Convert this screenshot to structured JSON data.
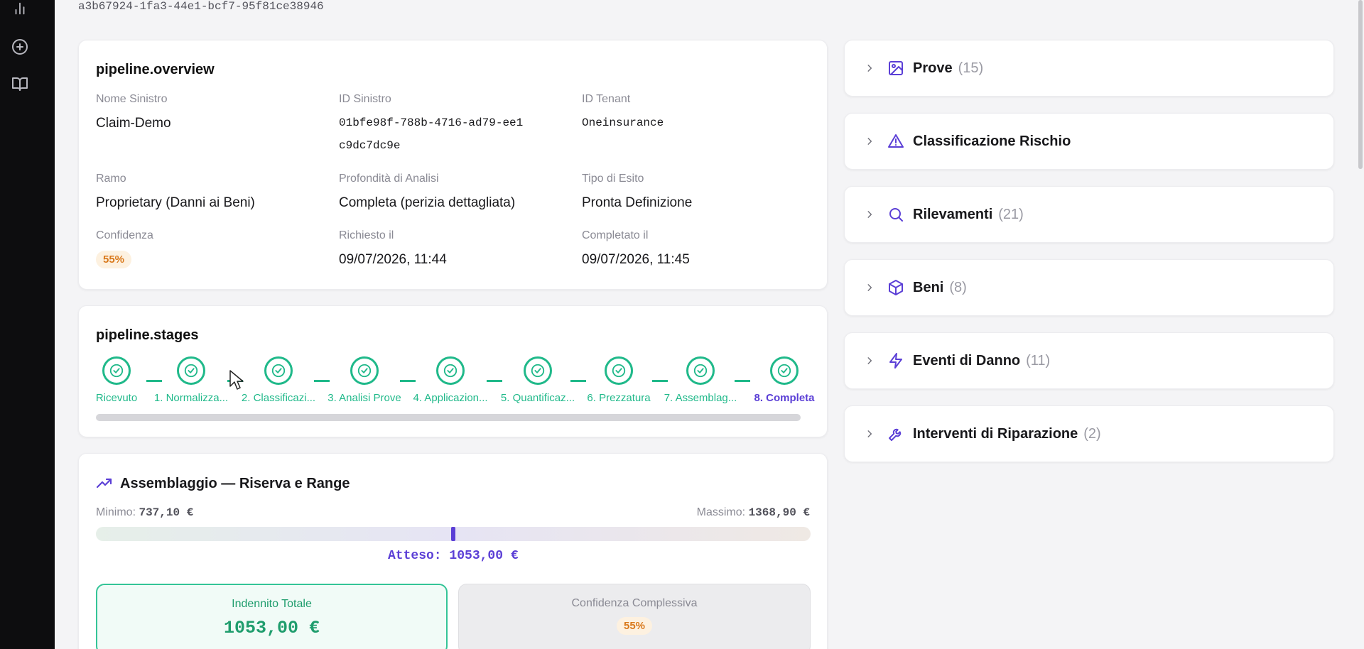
{
  "colors": {
    "accent": "#5b3fd6",
    "success": "#20b98a",
    "warning": "#d9791c",
    "rail": "#0d0d0f"
  },
  "rail": {
    "icons": [
      "bar-chart-icon",
      "add-circle-icon",
      "book-open-icon"
    ]
  },
  "header": {
    "id_text": "a3b67924-1fa3-44e1-bcf7-95f81ce38946"
  },
  "overview": {
    "title": "pipeline.overview",
    "fields": [
      {
        "label": "Nome Sinistro",
        "value": "Claim-Demo"
      },
      {
        "label": "ID Sinistro",
        "value": "01bfe98f-788b-4716-ad79-ee1c9dc7dc9e"
      },
      {
        "label": "ID Tenant",
        "value": "Oneinsurance"
      },
      {
        "label": "Ramo",
        "value": "Proprietary (Danni ai Beni)"
      },
      {
        "label": "Profondità di Analisi",
        "value": "Completa (perizia dettagliata)"
      },
      {
        "label": "Tipo di Esito",
        "value": "Pronta Definizione"
      },
      {
        "label": "Confidenza",
        "value": "55%"
      },
      {
        "label": "Richiesto il",
        "value": "09/07/2026, 11:44"
      },
      {
        "label": "Completato il",
        "value": "09/07/2026, 11:45"
      }
    ]
  },
  "stages": {
    "title": "pipeline.stages",
    "items": [
      {
        "label": "Ricevuto",
        "status": "done"
      },
      {
        "label": "1. Normalizza...",
        "status": "done"
      },
      {
        "label": "2. Classificazi...",
        "status": "done"
      },
      {
        "label": "3. Analisi Prove",
        "status": "done"
      },
      {
        "label": "4. Applicazion...",
        "status": "done"
      },
      {
        "label": "5. Quantificaz...",
        "status": "done"
      },
      {
        "label": "6. Prezzatura",
        "status": "done"
      },
      {
        "label": "7. Assemblag...",
        "status": "done"
      },
      {
        "label": "8. Completa",
        "status": "active"
      }
    ]
  },
  "assembly": {
    "title": "Assemblaggio — Riserva e Range",
    "min_label": "Minimo:",
    "min_value": "737,10 €",
    "max_label": "Massimo:",
    "max_value": "1368,90 €",
    "expected_text": "Atteso: 1053,00 €",
    "total_label": "Indennito Totale",
    "total_value": "1053,00 €",
    "confidence_label": "Confidenza Complessiva",
    "confidence_value": "55%"
  },
  "accordion": [
    {
      "title": "Prove",
      "count": "(15)",
      "icon": "image-icon"
    },
    {
      "title": "Classificazione Rischio",
      "count": "",
      "icon": "warning-triangle-icon"
    },
    {
      "title": "Rilevamenti",
      "count": "(21)",
      "icon": "search-icon"
    },
    {
      "title": "Beni",
      "count": "(8)",
      "icon": "box-icon"
    },
    {
      "title": "Eventi di Danno",
      "count": "(11)",
      "icon": "lightning-icon"
    },
    {
      "title": "Interventi di Riparazione",
      "count": "(2)",
      "icon": "wrench-icon"
    }
  ]
}
